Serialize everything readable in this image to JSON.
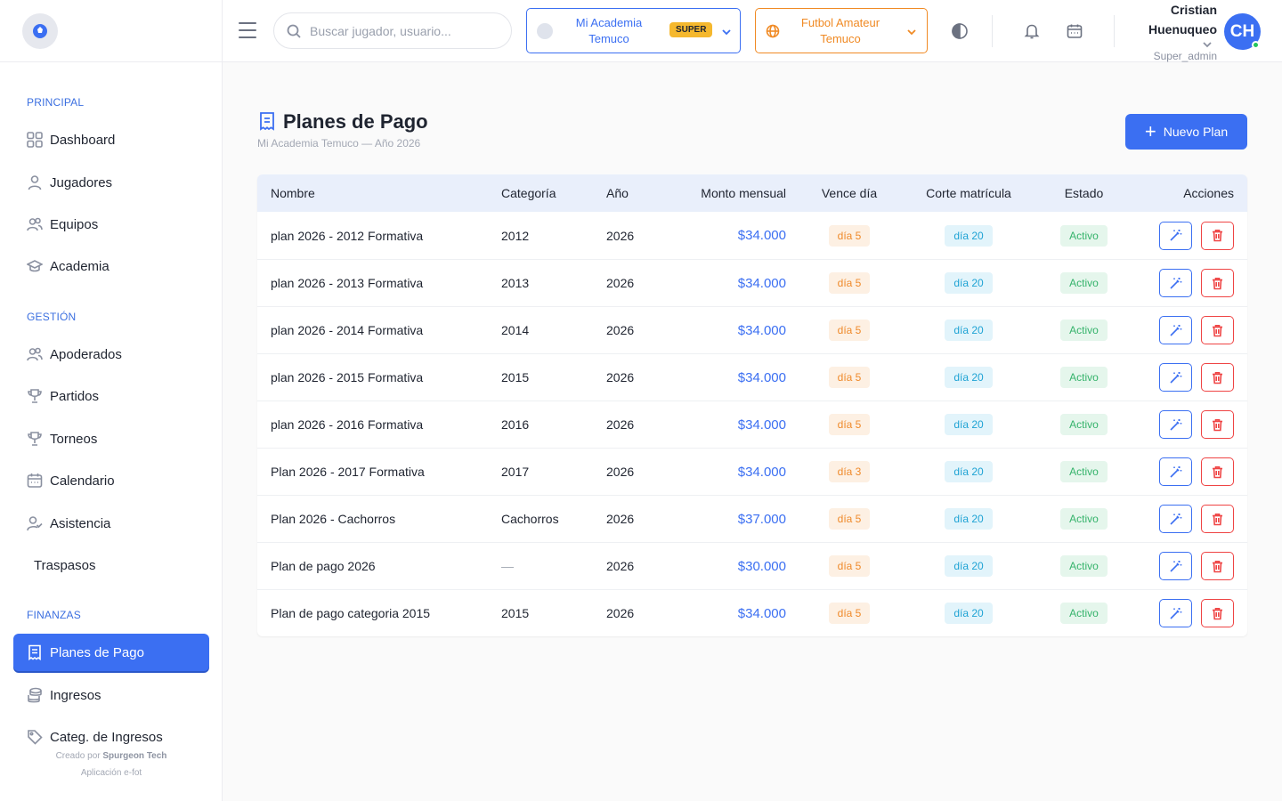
{
  "sidebar": {
    "sections": [
      {
        "title": "PRINCIPAL",
        "items": [
          {
            "label": "Dashboard",
            "icon": "dashboard-icon"
          },
          {
            "label": "Jugadores",
            "icon": "user-icon"
          },
          {
            "label": "Equipos",
            "icon": "users-icon"
          },
          {
            "label": "Academia",
            "icon": "graduation-cap-icon"
          }
        ]
      },
      {
        "title": "GESTIÓN",
        "items": [
          {
            "label": "Apoderados",
            "icon": "users-icon"
          },
          {
            "label": "Partidos",
            "icon": "trophy-icon"
          },
          {
            "label": "Torneos",
            "icon": "trophy-icon"
          },
          {
            "label": "Calendario",
            "icon": "calendar-icon"
          },
          {
            "label": "Asistencia",
            "icon": "user-check-icon"
          },
          {
            "label": "Traspasos",
            "icon": ""
          }
        ]
      },
      {
        "title": "FINANZAS",
        "items": [
          {
            "label": "Planes de Pago",
            "icon": "receipt-icon",
            "active": true
          },
          {
            "label": "Ingresos",
            "icon": "coins-icon"
          },
          {
            "label": "Categ. de Ingresos",
            "icon": "tag-icon"
          }
        ]
      }
    ],
    "footer": {
      "created_by": "Creado por",
      "company": "Spurgeon Tech",
      "app": "Aplicación e-fot"
    }
  },
  "header": {
    "search_placeholder": "Buscar jugador, usuario...",
    "academy": {
      "line1": "Mi Academia",
      "line2": "Temuco",
      "badge": "SUPER"
    },
    "team": {
      "line1": "Futbol Amateur",
      "line2": "Temuco"
    },
    "user": {
      "first": "Cristian",
      "last": "Huenuqueo",
      "role": "Super_admin",
      "initials": "CH"
    }
  },
  "page": {
    "title": "Planes de Pago",
    "subtitle": "Mi Academia Temuco — Año 2026",
    "new_button": "Nuevo Plan"
  },
  "table": {
    "columns": [
      "Nombre",
      "Categoría",
      "Año",
      "Monto mensual",
      "Vence día",
      "Corte matrícula",
      "Estado",
      "Acciones"
    ],
    "rows": [
      {
        "name": "plan 2026 - 2012 Formativa",
        "category": "2012",
        "year": "2026",
        "amount": "$34.000",
        "due": "día 5",
        "cutoff": "día 20",
        "status": "Activo"
      },
      {
        "name": "plan 2026 - 2013 Formativa",
        "category": "2013",
        "year": "2026",
        "amount": "$34.000",
        "due": "día 5",
        "cutoff": "día 20",
        "status": "Activo"
      },
      {
        "name": "plan 2026 - 2014 Formativa",
        "category": "2014",
        "year": "2026",
        "amount": "$34.000",
        "due": "día 5",
        "cutoff": "día 20",
        "status": "Activo"
      },
      {
        "name": "plan 2026 - 2015 Formativa",
        "category": "2015",
        "year": "2026",
        "amount": "$34.000",
        "due": "día 5",
        "cutoff": "día 20",
        "status": "Activo"
      },
      {
        "name": "plan 2026 - 2016 Formativa",
        "category": "2016",
        "year": "2026",
        "amount": "$34.000",
        "due": "día 5",
        "cutoff": "día 20",
        "status": "Activo"
      },
      {
        "name": "Plan 2026 - 2017 Formativa",
        "category": "2017",
        "year": "2026",
        "amount": "$34.000",
        "due": "día 3",
        "cutoff": "día 20",
        "status": "Activo"
      },
      {
        "name": "Plan 2026 - Cachorros",
        "category": "Cachorros",
        "year": "2026",
        "amount": "$37.000",
        "due": "día 5",
        "cutoff": "día 20",
        "status": "Activo"
      },
      {
        "name": "Plan de pago 2026",
        "category": "—",
        "year": "2026",
        "amount": "$30.000",
        "due": "día 5",
        "cutoff": "día 20",
        "status": "Activo"
      },
      {
        "name": "Plan de pago categoria 2015",
        "category": "2015",
        "year": "2026",
        "amount": "$34.000",
        "due": "día 5",
        "cutoff": "día 20",
        "status": "Activo"
      }
    ]
  },
  "colors": {
    "primary": "#3b6ff2",
    "orange": "#f08a24",
    "green": "#35b36b",
    "cyan": "#1fa3d4",
    "danger": "#ef4444"
  }
}
